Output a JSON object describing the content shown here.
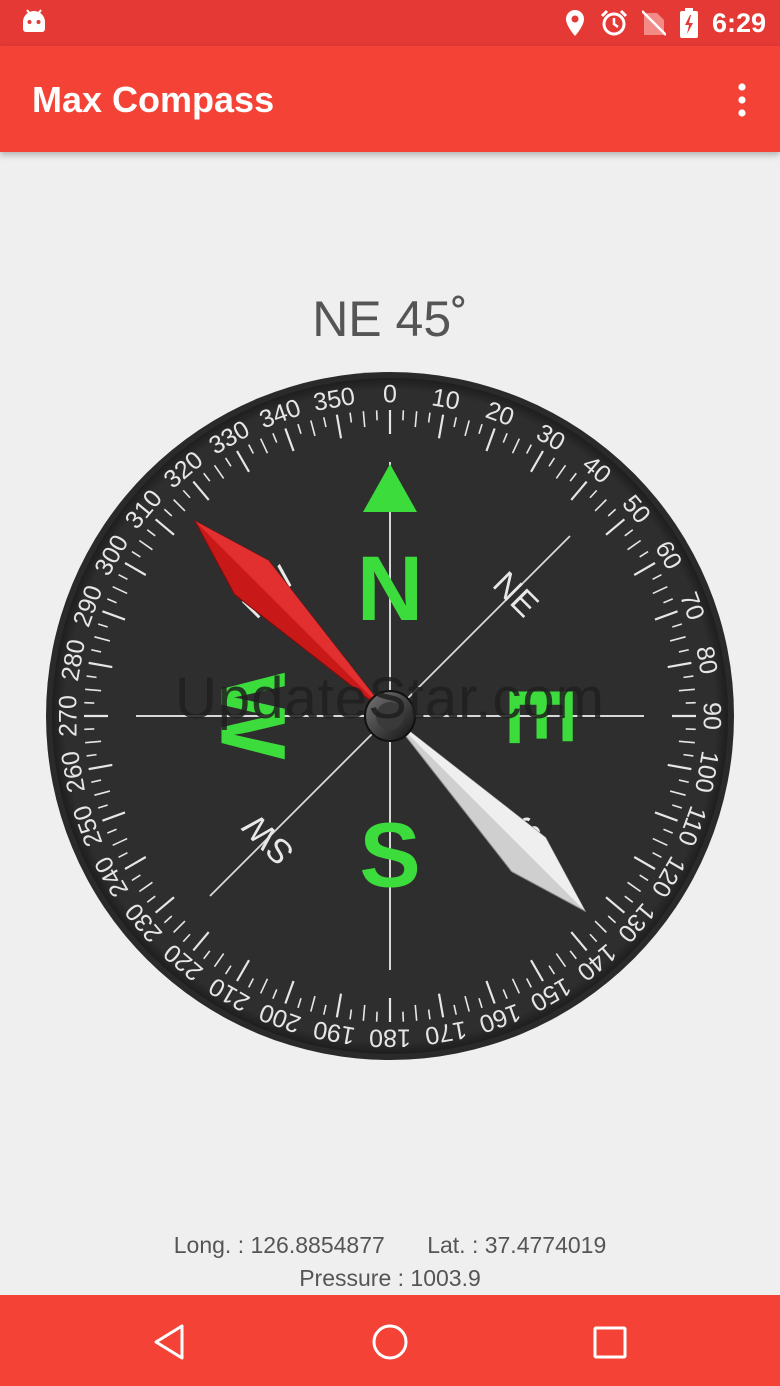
{
  "status_bar": {
    "time": "6:29",
    "icons": [
      "android-icon",
      "location-icon",
      "alarm-icon",
      "no-sim-icon",
      "battery-charging-icon"
    ]
  },
  "app_bar": {
    "title": "Max Compass",
    "menu_icon": "more-vert-icon"
  },
  "compass": {
    "heading_text": "NE 45˚",
    "heading_degrees": 45,
    "dial_labels": [
      "0",
      "10",
      "20",
      "30",
      "40",
      "50",
      "60",
      "70",
      "80",
      "90",
      "100",
      "110",
      "120",
      "130",
      "140",
      "150",
      "160",
      "170",
      "180",
      "190",
      "200",
      "210",
      "220",
      "230",
      "240",
      "250",
      "260",
      "270",
      "280",
      "290",
      "300",
      "310",
      "320",
      "330",
      "340",
      "350"
    ],
    "cardinals": {
      "n": "N",
      "e": "E",
      "s": "S",
      "w": "W"
    },
    "intercardinals": {
      "ne": "NE",
      "se": "SE",
      "sw": "SW",
      "nw": "NW"
    },
    "colors": {
      "cardinal": "#3ddc3d",
      "needle_north": "#c81818",
      "needle_south": "#d8d8d8",
      "dial": "#2c2c2c"
    }
  },
  "watermark": "UpdateStar.com",
  "info": {
    "longitude": "Long. : 126.8854877",
    "latitude": "Lat. : 37.4774019",
    "pressure": "Pressure : 1003.9"
  },
  "nav_bar": {
    "icons": [
      "back-icon",
      "home-icon",
      "recents-icon"
    ]
  }
}
